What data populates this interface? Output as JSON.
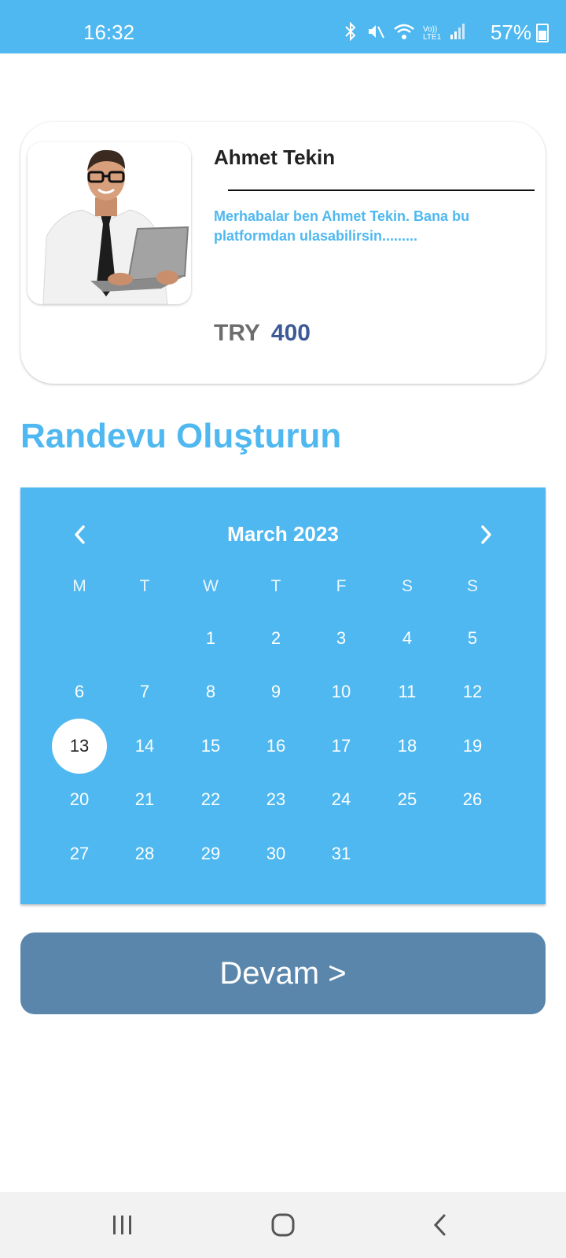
{
  "status": {
    "time": "16:32",
    "battery": "57%",
    "network": "Vo)) LTE1"
  },
  "profile": {
    "name": "Ahmet Tekin",
    "bio": "Merhabalar ben Ahmet Tekin. Bana bu platformdan ulasabilirsin.........",
    "currency": "TRY",
    "price": "400"
  },
  "section_title": "Randevu Oluşturun",
  "calendar": {
    "month_label": "March 2023",
    "weekdays": [
      "M",
      "T",
      "W",
      "T",
      "F",
      "S",
      "S"
    ],
    "first_weekday_index": 2,
    "days": [
      "1",
      "2",
      "3",
      "4",
      "5",
      "6",
      "7",
      "8",
      "9",
      "10",
      "11",
      "12",
      "13",
      "14",
      "15",
      "16",
      "17",
      "18",
      "19",
      "20",
      "21",
      "22",
      "23",
      "24",
      "25",
      "26",
      "27",
      "28",
      "29",
      "30",
      "31"
    ],
    "selected_day": "13"
  },
  "continue_label": "Devam >",
  "colors": {
    "primary": "#4fb8f0",
    "button": "#5a86ac",
    "price": "#3e5a96"
  },
  "icons": [
    "bluetooth-icon",
    "mute-icon",
    "wifi-icon",
    "signal-icon",
    "battery-icon",
    "chevron-left-icon",
    "chevron-right-icon",
    "recent-apps-icon",
    "home-icon",
    "back-icon"
  ]
}
